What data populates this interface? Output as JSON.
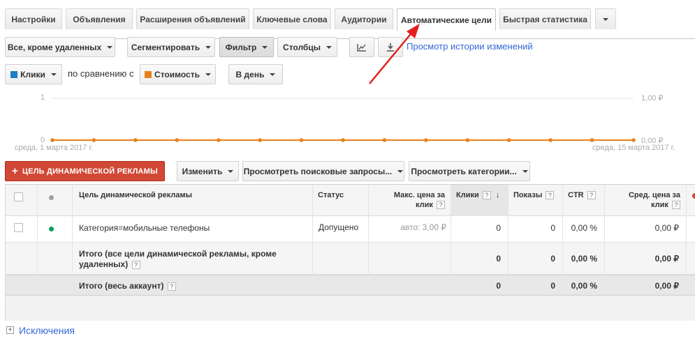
{
  "tabs": [
    {
      "label": "Настройки"
    },
    {
      "label": "Объявления"
    },
    {
      "label": "Расширения объявлений"
    },
    {
      "label": "Ключевые слова"
    },
    {
      "label": "Аудитории"
    },
    {
      "label": "Автоматические цели"
    },
    {
      "label": "Быстрая статистика"
    }
  ],
  "active_tab": "Автоматические цели",
  "toolbar": {
    "filter_status": "Все, кроме удаленных",
    "segment": "Сегментировать",
    "filter": "Фильтр",
    "columns": "Столбцы",
    "history_link": "Просмотр истории изменений"
  },
  "metrics": {
    "metric1": "Клики",
    "compare_text": "по сравнению с",
    "metric2": "Стоимость",
    "period": "В день",
    "metric1_color": "#1c7fc1",
    "metric2_color": "#e8801a"
  },
  "chart_data": {
    "type": "line",
    "x": [
      "среда, 1 марта 2017 г.",
      "",
      "",
      "",
      "",
      "",
      "",
      "",
      "",
      "",
      "",
      "",
      "",
      "",
      "среда, 15 марта 2017 г."
    ],
    "series": [
      {
        "name": "Клики",
        "values": [
          0,
          0,
          0,
          0,
          0,
          0,
          0,
          0,
          0,
          0,
          0,
          0,
          0,
          0,
          0
        ]
      },
      {
        "name": "Стоимость",
        "values": [
          0,
          0,
          0,
          0,
          0,
          0,
          0,
          0,
          0,
          0,
          0,
          0,
          0,
          0,
          0
        ]
      }
    ],
    "left_axis": {
      "top": "1",
      "bottom": "0"
    },
    "right_axis": {
      "top": "1,00 ₽",
      "bottom": "0,00 ₽"
    },
    "date_start": "среда, 1 марта 2017 г.",
    "date_end": "среда, 15 марта 2017 г.",
    "ylim": [
      0,
      1
    ],
    "grid": true
  },
  "actions": {
    "add_target": "ЦЕЛЬ ДИНАМИЧЕСКОЙ РЕКЛАМЫ",
    "edit": "Изменить",
    "search_queries": "Просмотреть поисковые запросы...",
    "categories": "Просмотреть категории..."
  },
  "table": {
    "headers": {
      "target": "Цель динамической рекламы",
      "status": "Статус",
      "max_cpc_line1": "Макс. цена за",
      "max_cpc_line2": "клик",
      "clicks": "Клики",
      "impressions": "Показы",
      "ctr": "CTR",
      "avg_cpc_line1": "Сред. цена за",
      "avg_cpc_line2": "клик",
      "help": "?"
    },
    "row": {
      "target": "Категория=мобильные телефоны",
      "status": "Допущено",
      "max_cpc": "авто: 3,00 ₽",
      "clicks": "0",
      "impressions": "0",
      "ctr": "0,00 %",
      "avg_cpc": "0,00 ₽",
      "status_color": "#0f9d58"
    },
    "total_filtered": {
      "label_line1": "Итого (все цели динамической рекламы, кроме",
      "label_line2": "удаленных)",
      "clicks": "0",
      "impressions": "0",
      "ctr": "0,00 %",
      "avg_cpc": "0,00 ₽"
    },
    "total_account": {
      "label": "Итого (весь аккаунт)",
      "clicks": "0",
      "impressions": "0",
      "ctr": "0,00 %",
      "avg_cpc": "0,00 ₽"
    }
  },
  "exclusions": {
    "label": "Исключения"
  }
}
